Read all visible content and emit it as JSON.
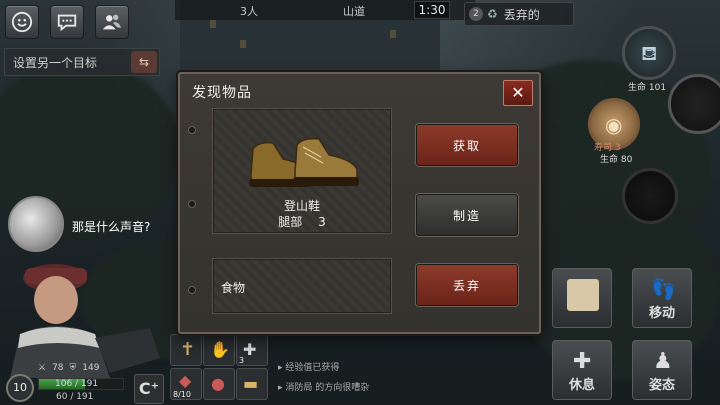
{
  "topbar": {
    "players": "3人",
    "location": "山道",
    "timer": "1:30",
    "discard_badge": "2",
    "discard_label": "丢弃的"
  },
  "target": {
    "placeholder": "设置另一个目标",
    "arrows": "⇆"
  },
  "speech": {
    "text": "那是什么声音?"
  },
  "dialog": {
    "title": "发现物品",
    "close": "✕",
    "item": {
      "name": "登山鞋",
      "slot": "腿部",
      "value": "3"
    },
    "food_label": "食物",
    "buttons": {
      "take": "获取",
      "craft": "制造",
      "discard": "丢弃"
    }
  },
  "player": {
    "level": "10",
    "attack": "78",
    "defense": "149",
    "hp_text": "106 / 191",
    "hp_fraction": 0.55,
    "xp_text": "60 / 191",
    "cplus": "C⁺"
  },
  "inventory": {
    "slots": [
      {
        "icon": "cross-icon",
        "count": ""
      },
      {
        "icon": "hands-icon",
        "count": ""
      },
      {
        "icon": "bandage-icon",
        "count": "3"
      },
      {
        "icon": "bag-icon",
        "count": "8/10"
      },
      {
        "icon": "meat-icon",
        "count": ""
      },
      {
        "icon": "bread-icon",
        "count": ""
      }
    ]
  },
  "log": {
    "lines": [
      "经验值已获得",
      "消防局 的方向很嘈杂"
    ]
  },
  "right_panel": {
    "status_a": {
      "value_text": "生命 101"
    },
    "status_b": {
      "name": "寿司 3",
      "value_text": "生命 80"
    },
    "actions": {
      "rest": "休息",
      "move": "移动",
      "pose": "姿态"
    }
  },
  "colors": {
    "accent_red": "#8c3a2a",
    "hp_green": "#4aa24a",
    "food_text": "#cf8c6b"
  }
}
